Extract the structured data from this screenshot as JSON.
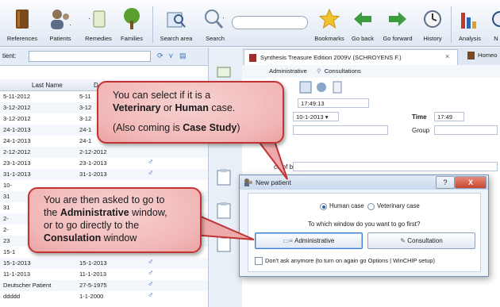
{
  "toolbar": {
    "items": [
      {
        "label": "References",
        "icon": "books-icon"
      },
      {
        "label": "Patients",
        "icon": "patients-icon"
      },
      {
        "label": "Remedies",
        "icon": "remedies-icon"
      },
      {
        "label": "Families",
        "icon": "tree-icon"
      },
      {
        "label": "Search area",
        "icon": "search-area-icon"
      },
      {
        "label": "Search",
        "icon": "magnifier-icon"
      },
      {
        "label": "Bookmarks",
        "icon": "star-icon"
      },
      {
        "label": "Go back",
        "icon": "arrow-left-icon"
      },
      {
        "label": "Go forward",
        "icon": "arrow-right-icon"
      },
      {
        "label": "History",
        "icon": "clock-icon"
      },
      {
        "label": "Analysis",
        "icon": "chart-icon"
      },
      {
        "label": "N",
        "icon": "more-icon"
      }
    ]
  },
  "patients": {
    "search_label": "tient:",
    "columns": [
      "Last Name",
      "D"
    ],
    "rows": [
      {
        "name": "5-11-2012",
        "date": "5-11",
        "sex": ""
      },
      {
        "name": "3-12-2012",
        "date": "3-12",
        "sex": ""
      },
      {
        "name": "3-12-2012",
        "date": "3-12",
        "sex": ""
      },
      {
        "name": "24-1-2013",
        "date": "24-1",
        "sex": ""
      },
      {
        "name": "24-1-2013",
        "date": "24-1",
        "sex": ""
      },
      {
        "name": "2-12-2012",
        "date": "2-12-2012",
        "sex": ""
      },
      {
        "name": "23-1-2013",
        "date": "23-1-2013",
        "sex": "♂"
      },
      {
        "name": "31-1-2013",
        "date": "31-1-2013",
        "sex": "♂"
      },
      {
        "name": "10-",
        "date": "",
        "sex": ""
      },
      {
        "name": "31",
        "date": "",
        "sex": ""
      },
      {
        "name": "31",
        "date": "",
        "sex": ""
      },
      {
        "name": "2-",
        "date": "",
        "sex": ""
      },
      {
        "name": "2-",
        "date": "",
        "sex": ""
      },
      {
        "name": "23",
        "date": "",
        "sex": ""
      },
      {
        "name": "15-1",
        "date": "",
        "sex": ""
      },
      {
        "name": "15-1-2013",
        "date": "15-1-2013",
        "sex": "♂"
      },
      {
        "name": "11-1-2013",
        "date": "11-1-2013",
        "sex": "♂"
      },
      {
        "name": "Deutscher Patient",
        "date": "27-5-1975",
        "sex": "♂"
      },
      {
        "name": "ddddd",
        "date": "1-1-2000",
        "sex": "♂"
      }
    ]
  },
  "book": {
    "tab_title": "Synthesis Treasure Edition 2009V (SCHROYENS F.)",
    "tab_close": "×",
    "tab2_title": "Homeo",
    "subtabs": {
      "admin": "Administrative",
      "consult": "Consultations"
    }
  },
  "form": {
    "time_value": "17:49:13",
    "birth_label": "th",
    "birth_value": "10-1-2013",
    "time_label": "Time",
    "time_field": "17:49",
    "group_label": "Group",
    "place_of_birth_label": "ce of birth"
  },
  "dialog": {
    "title": "New patient",
    "help": "?",
    "close": "X",
    "human_case": "Human case",
    "veterinary_case": "Veterinary case",
    "question": "To which window do you want to go first?",
    "admin_button": "Administrative",
    "consult_button": "Consultation",
    "dont_ask": "Don't ask anymore (to turn on again go Options | WinCHIP setup)"
  },
  "callout1": {
    "line1a": "You can select if it is a",
    "line2a": "Veterinary",
    "line2b": " or ",
    "line2c": "Human",
    "line2d": " case.",
    "line3a": "(Also coming is ",
    "line3b": "Case Study",
    "line3c": ")"
  },
  "callout2": {
    "line1": "You are then asked to go to",
    "line2a": "the ",
    "line2b": "Administrative",
    "line2c": " window,",
    "line3": "or to go directly to the",
    "line4a": "Consulation",
    "line4b": " window"
  }
}
